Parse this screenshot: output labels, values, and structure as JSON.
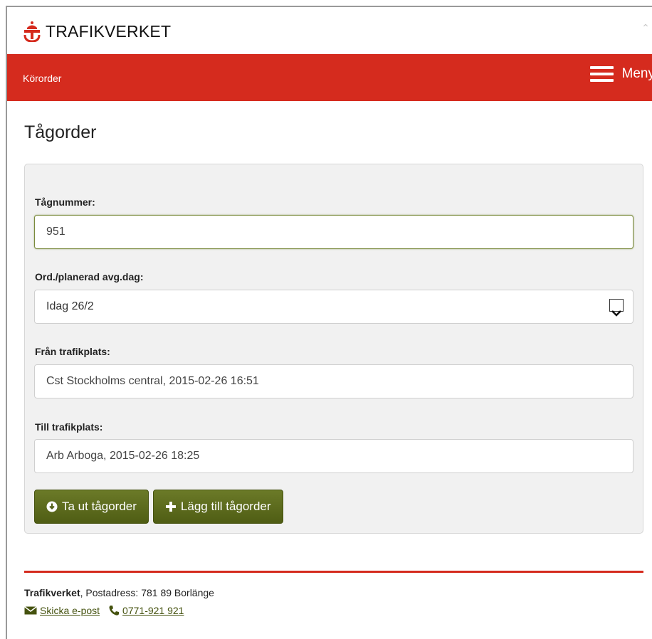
{
  "brand": {
    "name": "TRAFIKVERKET",
    "accent": "#d52b1e",
    "button_color": "#5a6a1a"
  },
  "nav": {
    "breadcrumb": "Körorder",
    "menu_label": "Meny",
    "menu_icon": "hamburger-icon"
  },
  "page": {
    "title": "Tågorder"
  },
  "form": {
    "train_number": {
      "label": "Tågnummer:",
      "value": "951"
    },
    "departure_day": {
      "label": "Ord./planerad avg.dag:",
      "selected": "Idag 26/2"
    },
    "from_station": {
      "label": "Från trafikplats:",
      "value": "Cst Stockholms central, 2015-02-26 16:51"
    },
    "to_station": {
      "label": "Till trafikplats:",
      "value": "Arb Arboga, 2015-02-26 18:25"
    },
    "actions": {
      "take_out": "Ta ut tågorder",
      "add": "Lägg till tågorder"
    }
  },
  "footer": {
    "org": "Trafikverket",
    "address": ", Postadress: 781 89 Borlänge",
    "email_link": "Skicka e-post",
    "phone_link": "0771-921 921"
  }
}
